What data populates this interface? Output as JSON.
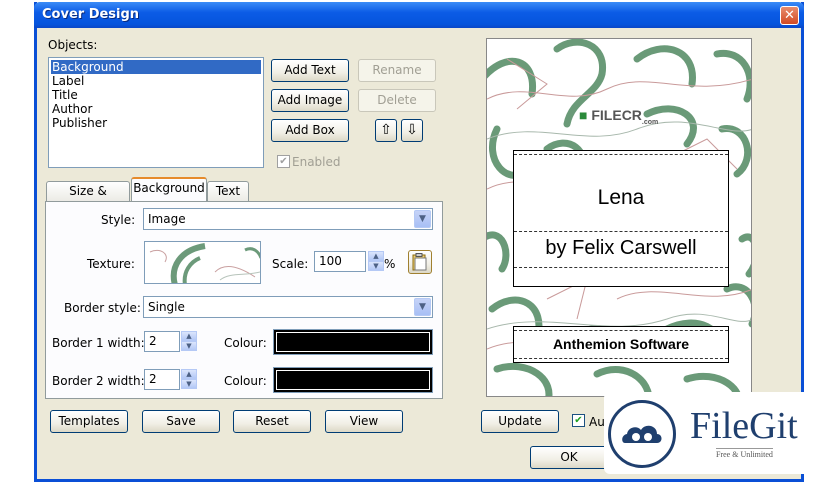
{
  "window": {
    "title": "Cover Design",
    "close_glyph": "✕"
  },
  "objects": {
    "label": "Objects:",
    "items": [
      "Background",
      "Label",
      "Title",
      "Author",
      "Publisher"
    ],
    "selected": "Background"
  },
  "buttons": {
    "add_text": "Add Text",
    "add_image": "Add Image",
    "add_box": "Add Box",
    "rename": "Rename",
    "delete": "Delete",
    "move_up": "⇧",
    "move_down": "⇩",
    "enabled_label": "Enabled",
    "templates": "Templates",
    "save": "Save",
    "reset": "Reset",
    "view": "View",
    "update": "Update",
    "auto_label": "Au",
    "ok": "OK"
  },
  "tabs": [
    "Size & Position",
    "Background",
    "Text"
  ],
  "active_tab": "Background",
  "background_tab": {
    "style_label": "Style:",
    "style_value": "Image",
    "texture_label": "Texture:",
    "scale_label": "Scale:",
    "scale_value": "100",
    "scale_unit": "%",
    "border_style_label": "Border style:",
    "border_style_value": "Single",
    "border1_label": "Border 1 width:",
    "border1_value": "2",
    "border2_label": "Border 2 width:",
    "border2_value": "2",
    "colour_label": "Colour:",
    "colour1": "#000000",
    "colour2": "#000000"
  },
  "preview": {
    "title": "Lena",
    "author": "by Felix Carswell",
    "publisher": "Anthemion Software",
    "watermark": "FILECR",
    "watermark_sub": ".com"
  },
  "overlay": {
    "brand": "FileGit",
    "tagline": "Free & Unlimited"
  },
  "colors": {
    "title_bar": "#0554dd",
    "selection": "#316ac5",
    "texture_green": "#5f8f6c",
    "texture_pink": "#c98a8a"
  }
}
